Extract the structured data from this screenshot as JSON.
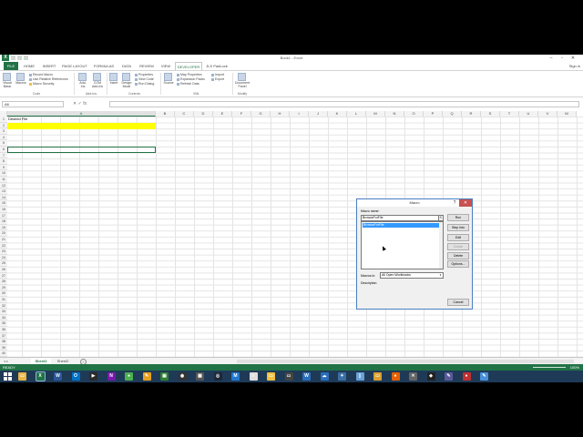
{
  "window": {
    "title": "Book1 - Excel",
    "signin": "Sign in"
  },
  "tabs": [
    "FILE",
    "HOME",
    "INSERT",
    "PAGE LAYOUT",
    "FORMULAS",
    "DATA",
    "REVIEW",
    "VIEW",
    "DEVELOPER",
    "JLS PadLock"
  ],
  "active_tab": "DEVELOPER",
  "ribbon": {
    "code": {
      "visual_basic": "Visual Basic",
      "macros": "Macros",
      "record_macro": "Record Macro",
      "relative": "Use Relative References",
      "security": "Macro Security",
      "group": "Code"
    },
    "addins": {
      "addins": "Add-Ins",
      "com": "COM Add-Ins",
      "group": "Add-Ins"
    },
    "controls": {
      "insert": "Insert",
      "design": "Design Mode",
      "properties": "Properties",
      "view_code": "View Code",
      "run_dialog": "Run Dialog",
      "group": "Controls"
    },
    "xml": {
      "source": "Source",
      "map_properties": "Map Properties",
      "expansion_packs": "Expansion Packs",
      "refresh": "Refresh Data",
      "import": "Import",
      "export": "Export",
      "group": "XML"
    },
    "modify": {
      "doc_panel": "Document Panel",
      "group": "Modify"
    }
  },
  "formula_bar": {
    "name_box": "A6",
    "fx": "fx",
    "content": ""
  },
  "columns": [
    "A",
    "B",
    "C",
    "D",
    "E",
    "F",
    "G",
    "H",
    "I",
    "J",
    "K",
    "L",
    "M",
    "N",
    "O",
    "P",
    "Q",
    "R",
    "S",
    "T",
    "U",
    "V",
    "W"
  ],
  "rows": [
    "1",
    "2",
    "3",
    "4",
    "5",
    "6",
    "7",
    "8",
    "9",
    "10",
    "11",
    "12",
    "13",
    "14",
    "15",
    "16",
    "17",
    "18",
    "19",
    "20",
    "21",
    "22",
    "23",
    "24",
    "25",
    "26",
    "27",
    "28",
    "29",
    "30",
    "31",
    "32",
    "33",
    "34",
    "35",
    "36",
    "37",
    "38",
    "39",
    "40"
  ],
  "cells": {
    "a1": "Desired File"
  },
  "sheets": [
    "Sheet1",
    "Sheet2"
  ],
  "status": {
    "ready": "READY",
    "zoom": "100%"
  },
  "dialog": {
    "title": "Macro",
    "help": "?",
    "close": "✕",
    "macro_name_label": "Macro name:",
    "macro_name_value": "BrowseForFile",
    "list": [
      "BrowseForFile"
    ],
    "buttons": [
      "Run",
      "Step Into",
      "Edit",
      "Create",
      "Delete",
      "Options..."
    ],
    "disabled_buttons": [
      "Create"
    ],
    "macros_in_label": "Macros in:",
    "macros_in_value": "All Open Workbooks",
    "description_label": "Description",
    "cancel": "Cancel"
  },
  "taskbar": {
    "icons": [
      {
        "name": "folder-icon",
        "color": "#e8b545",
        "glyph": "▭"
      },
      {
        "name": "excel-icon",
        "color": "#217346",
        "glyph": "X"
      },
      {
        "name": "word-icon",
        "color": "#2b5797",
        "glyph": "W"
      },
      {
        "name": "outlook-icon",
        "color": "#0072c6",
        "glyph": "O"
      },
      {
        "name": "media-icon",
        "color": "#2a2a2a",
        "glyph": "▶"
      },
      {
        "name": "onenote-icon",
        "color": "#7719aa",
        "glyph": "N"
      },
      {
        "name": "chrome-icon",
        "color": "#4caf50",
        "glyph": "●"
      },
      {
        "name": "paint-icon",
        "color": "#e8a020",
        "glyph": "✎"
      },
      {
        "name": "camtasia-icon",
        "color": "#2e7d32",
        "glyph": "▣"
      },
      {
        "name": "recorder-icon",
        "color": "#333333",
        "glyph": "◉"
      },
      {
        "name": "calculator-icon",
        "color": "#555555",
        "glyph": "▦"
      },
      {
        "name": "steam-icon",
        "color": "#1b2838",
        "glyph": "◎"
      },
      {
        "name": "metro-icon",
        "color": "#2277cc",
        "glyph": "M"
      },
      {
        "name": "notepad-icon",
        "color": "#dddddd",
        "glyph": "≡"
      },
      {
        "name": "explorer-icon",
        "color": "#f0c040",
        "glyph": "▭"
      },
      {
        "name": "display-icon",
        "color": "#444444",
        "glyph": "▭"
      },
      {
        "name": "app-icon",
        "color": "#2a6ebb",
        "glyph": "W"
      },
      {
        "name": "network-icon",
        "color": "#2a6ebb",
        "glyph": "☁"
      },
      {
        "name": "settings-icon",
        "color": "#3a6ea5",
        "glyph": "✦"
      },
      {
        "name": "window-icon",
        "color": "#6aa0d8",
        "glyph": "▯"
      },
      {
        "name": "folder2-icon",
        "color": "#d9a030",
        "glyph": "▭"
      },
      {
        "name": "firefox-icon",
        "color": "#e66000",
        "glyph": "●"
      },
      {
        "name": "tool-icon",
        "color": "#666666",
        "glyph": "✕"
      },
      {
        "name": "vba-icon",
        "color": "#222222",
        "glyph": "◈"
      },
      {
        "name": "editor-icon",
        "color": "#5a5a9a",
        "glyph": "✎"
      },
      {
        "name": "record-icon",
        "color": "#c03030",
        "glyph": "●"
      },
      {
        "name": "paint2-icon",
        "color": "#4a90d9",
        "glyph": "✎"
      }
    ]
  }
}
